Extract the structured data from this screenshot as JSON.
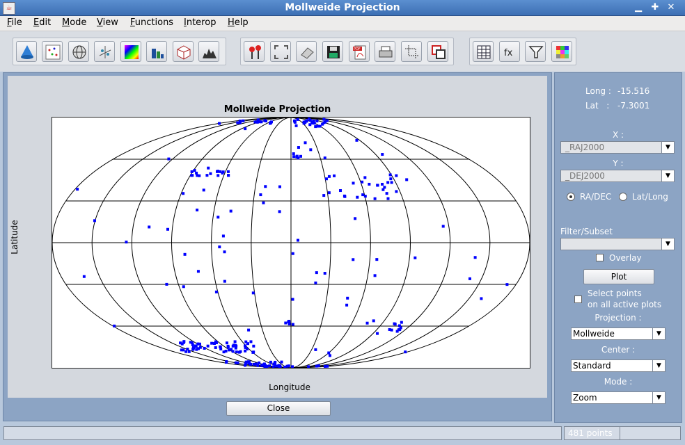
{
  "window": {
    "title": "Mollweide Projection"
  },
  "menu": [
    {
      "label": "File",
      "key": "F",
      "rest": "ile"
    },
    {
      "label": "Edit",
      "key": "E",
      "rest": "dit"
    },
    {
      "label": "Mode",
      "key": "M",
      "rest": "ode"
    },
    {
      "label": "View",
      "key": "V",
      "rest": "iew"
    },
    {
      "label": "Functions",
      "key": "F",
      "rest": "unctions"
    },
    {
      "label": "Interop",
      "key": "I",
      "rest": "nterop"
    },
    {
      "label": "Help",
      "key": "H",
      "rest": "elp"
    }
  ],
  "toolbar": {
    "group1": [
      "cone-icon",
      "scatter-plot-icon",
      "globe-icon",
      "scatter-3d-icon",
      "density-map-icon",
      "histogram-icon",
      "cube-icon",
      "mountain-chart-icon"
    ],
    "group2": [
      "pin-icon",
      "fit-view-icon",
      "eraser-icon",
      "save-icon",
      "pdf-icon",
      "print-icon",
      "crop-icon",
      "overlay-icon"
    ],
    "group3": [
      "table-icon",
      "fx-icon",
      "filter-icon",
      "color-grid-icon"
    ]
  },
  "plot": {
    "title": "Mollweide Projection",
    "xlabel": "Longitude",
    "ylabel": "Latitude",
    "point_color": "#0000ff",
    "grid_color": "#000000"
  },
  "close_label": "Close",
  "controls": {
    "long_label": "Long :",
    "long_value": "-15.516",
    "lat_label": "Lat   :",
    "lat_value": "-7.3001",
    "x_label": "X :",
    "x_value": "_RAJ2000",
    "y_label": "Y :",
    "y_value": "_DEJ2000",
    "radio_radec": "RA/DEC",
    "radio_latlong": "Lat/Long",
    "filter_label": "Filter/Subset",
    "filter_value": "",
    "overlay_label": "Overlay",
    "plot_button": "Plot",
    "select_points_line1": "Select points",
    "select_points_line2": "on all active plots",
    "projection_label": "Projection :",
    "projection_value": "Mollweide",
    "center_label": "Center :",
    "center_value": "Standard",
    "mode_label": "Mode :",
    "mode_value": "Zoom"
  },
  "status": {
    "points": "481 points"
  }
}
